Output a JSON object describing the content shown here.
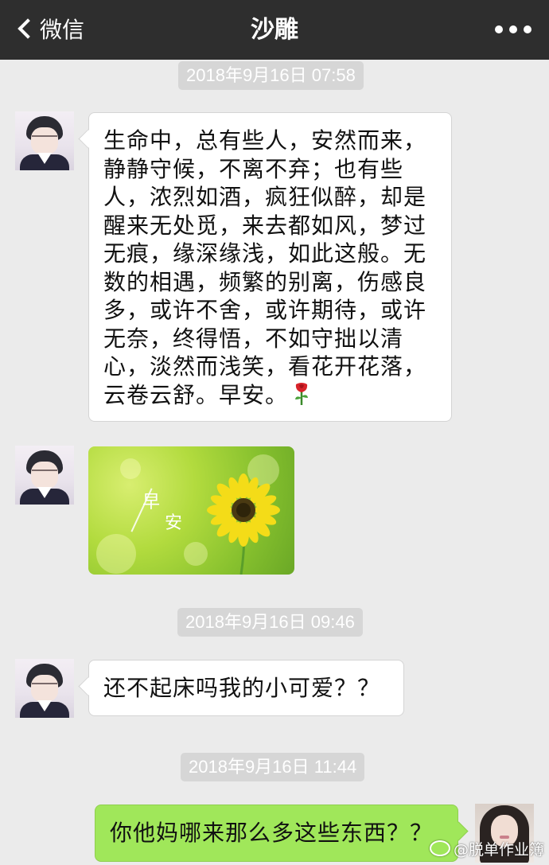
{
  "navbar": {
    "back_label": "微信",
    "title": "沙雕"
  },
  "timestamps": [
    "2018年9月16日 07:58",
    "2018年9月16日 09:46",
    "2018年9月16日 11:44"
  ],
  "messages": [
    {
      "sender": "other",
      "type": "text",
      "text": "生命中，总有些人，安然而来，\n静静守候，不离不弃；也有些\n人，浓烈如酒，疯狂似醉，却是\n醒来无处觅，来去都如风，梦过\n无痕，缘深缘浅，如此这般。无\n数的相遇，频繁的别离，伤感良\n多，或许不舍，或许期待，或许\n无奈，终得悟，不如守拙以清\n心，淡然而浅笑，看花开花落，\n云卷云舒。早安。",
      "emoji": "rose-icon"
    },
    {
      "sender": "other",
      "type": "image",
      "image_text": [
        "早",
        "安"
      ]
    },
    {
      "sender": "other",
      "type": "text",
      "text": "还不起床吗我的小可爱？？"
    },
    {
      "sender": "me",
      "type": "text",
      "text": "你他妈哪来那么多这些东西？？"
    }
  ],
  "watermark": "@脱单作业簿",
  "colors": {
    "navbar_bg": "#2e2e2e",
    "chat_bg": "#ebebeb",
    "my_bubble": "#a0e75a",
    "their_bubble": "#ffffff",
    "timestamp_bg": "#d6d6d6"
  }
}
